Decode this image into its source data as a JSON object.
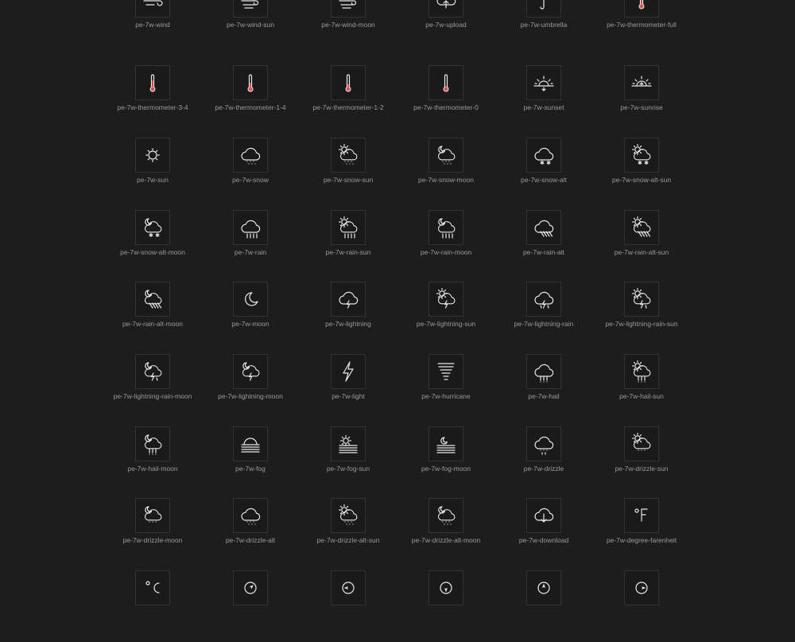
{
  "icons": [
    {
      "name": "pe-7w-wind",
      "glyph": "wind"
    },
    {
      "name": "pe-7w-wind-sun",
      "glyph": "wind-sun"
    },
    {
      "name": "pe-7w-wind-moon",
      "glyph": "wind-moon"
    },
    {
      "name": "pe-7w-upload",
      "glyph": "cloud-upload"
    },
    {
      "name": "pe-7w-umbrella",
      "glyph": "umbrella"
    },
    {
      "name": "pe-7w-thermometer-full",
      "glyph": "thermometer-full"
    },
    {
      "name": "pe-7w-thermometer-3-4",
      "glyph": "thermometer-3-4"
    },
    {
      "name": "pe-7w-thermometer-1-4",
      "glyph": "thermometer-1-4"
    },
    {
      "name": "pe-7w-thermometer-1-2",
      "glyph": "thermometer-1-2"
    },
    {
      "name": "pe-7w-thermometer-0",
      "glyph": "thermometer-0"
    },
    {
      "name": "pe-7w-sunset",
      "glyph": "sunset"
    },
    {
      "name": "pe-7w-sunrise",
      "glyph": "sunrise"
    },
    {
      "name": "pe-7w-sun",
      "glyph": "sun"
    },
    {
      "name": "pe-7w-snow",
      "glyph": "cloud-snow"
    },
    {
      "name": "pe-7w-snow-sun",
      "glyph": "cloud-snow-sun"
    },
    {
      "name": "pe-7w-snow-moon",
      "glyph": "cloud-snow-moon"
    },
    {
      "name": "pe-7w-snow-alt",
      "glyph": "cloud-snowflakes"
    },
    {
      "name": "pe-7w-snow-alt-sun",
      "glyph": "cloud-snowflakes-sun"
    },
    {
      "name": "pe-7w-snow-alt-moon",
      "glyph": "cloud-snowflakes-moon"
    },
    {
      "name": "pe-7w-rain",
      "glyph": "cloud-rain"
    },
    {
      "name": "pe-7w-rain-sun",
      "glyph": "cloud-rain-sun"
    },
    {
      "name": "pe-7w-rain-moon",
      "glyph": "cloud-rain-moon"
    },
    {
      "name": "pe-7w-rain-alt",
      "glyph": "cloud-rain-alt"
    },
    {
      "name": "pe-7w-rain-alt-sun",
      "glyph": "cloud-rain-alt-sun"
    },
    {
      "name": "pe-7w-rain-alt-moon",
      "glyph": "cloud-rain-alt-moon"
    },
    {
      "name": "pe-7w-moon",
      "glyph": "moon"
    },
    {
      "name": "pe-7w-lightning",
      "glyph": "cloud-lightning"
    },
    {
      "name": "pe-7w-lightning-sun",
      "glyph": "cloud-lightning-sun"
    },
    {
      "name": "pe-7w-lightning-rain",
      "glyph": "cloud-lightning-rain"
    },
    {
      "name": "pe-7w-lightning-rain-sun",
      "glyph": "cloud-lightning-rain-sun"
    },
    {
      "name": "pe-7w-lightning-rain-moon",
      "glyph": "cloud-lightning-rain-moon"
    },
    {
      "name": "pe-7w-lightning-moon",
      "glyph": "cloud-lightning-moon"
    },
    {
      "name": "pe-7w-light",
      "glyph": "bolt"
    },
    {
      "name": "pe-7w-hurricane",
      "glyph": "hurricane"
    },
    {
      "name": "pe-7w-hail",
      "glyph": "cloud-hail"
    },
    {
      "name": "pe-7w-hail-sun",
      "glyph": "cloud-hail-sun"
    },
    {
      "name": "pe-7w-hail-moon",
      "glyph": "cloud-hail-moon"
    },
    {
      "name": "pe-7w-fog",
      "glyph": "fog"
    },
    {
      "name": "pe-7w-fog-sun",
      "glyph": "fog-sun"
    },
    {
      "name": "pe-7w-fog-moon",
      "glyph": "fog-moon"
    },
    {
      "name": "pe-7w-drizzle",
      "glyph": "cloud-drizzle"
    },
    {
      "name": "pe-7w-drizzle-sun",
      "glyph": "cloud-drizzle-sun"
    },
    {
      "name": "pe-7w-drizzle-moon",
      "glyph": "cloud-drizzle-moon"
    },
    {
      "name": "pe-7w-drizzle-alt",
      "glyph": "cloud-drizzle-alt"
    },
    {
      "name": "pe-7w-drizzle-alt-sun",
      "glyph": "cloud-drizzle-alt-sun"
    },
    {
      "name": "pe-7w-drizzle-alt-moon",
      "glyph": "cloud-drizzle-alt-moon"
    },
    {
      "name": "pe-7w-download",
      "glyph": "cloud-download"
    },
    {
      "name": "pe-7w-degree-farenheit",
      "glyph": "degree-fahrenheit"
    },
    {
      "name": "",
      "glyph": "degree-celsius"
    },
    {
      "name": "",
      "glyph": "compass-north-east"
    },
    {
      "name": "",
      "glyph": "compass-west"
    },
    {
      "name": "",
      "glyph": "compass-south"
    },
    {
      "name": "",
      "glyph": "compass-north"
    },
    {
      "name": "",
      "glyph": "compass-east"
    }
  ],
  "colors": {
    "background": "#1d1d1d",
    "tile_border": "#323232",
    "icon_stroke": "#e8e8e8",
    "label_text": "#9a9a9a",
    "thermo_warm": "#d9534f",
    "thermo_cool": "#5b8fd6"
  }
}
